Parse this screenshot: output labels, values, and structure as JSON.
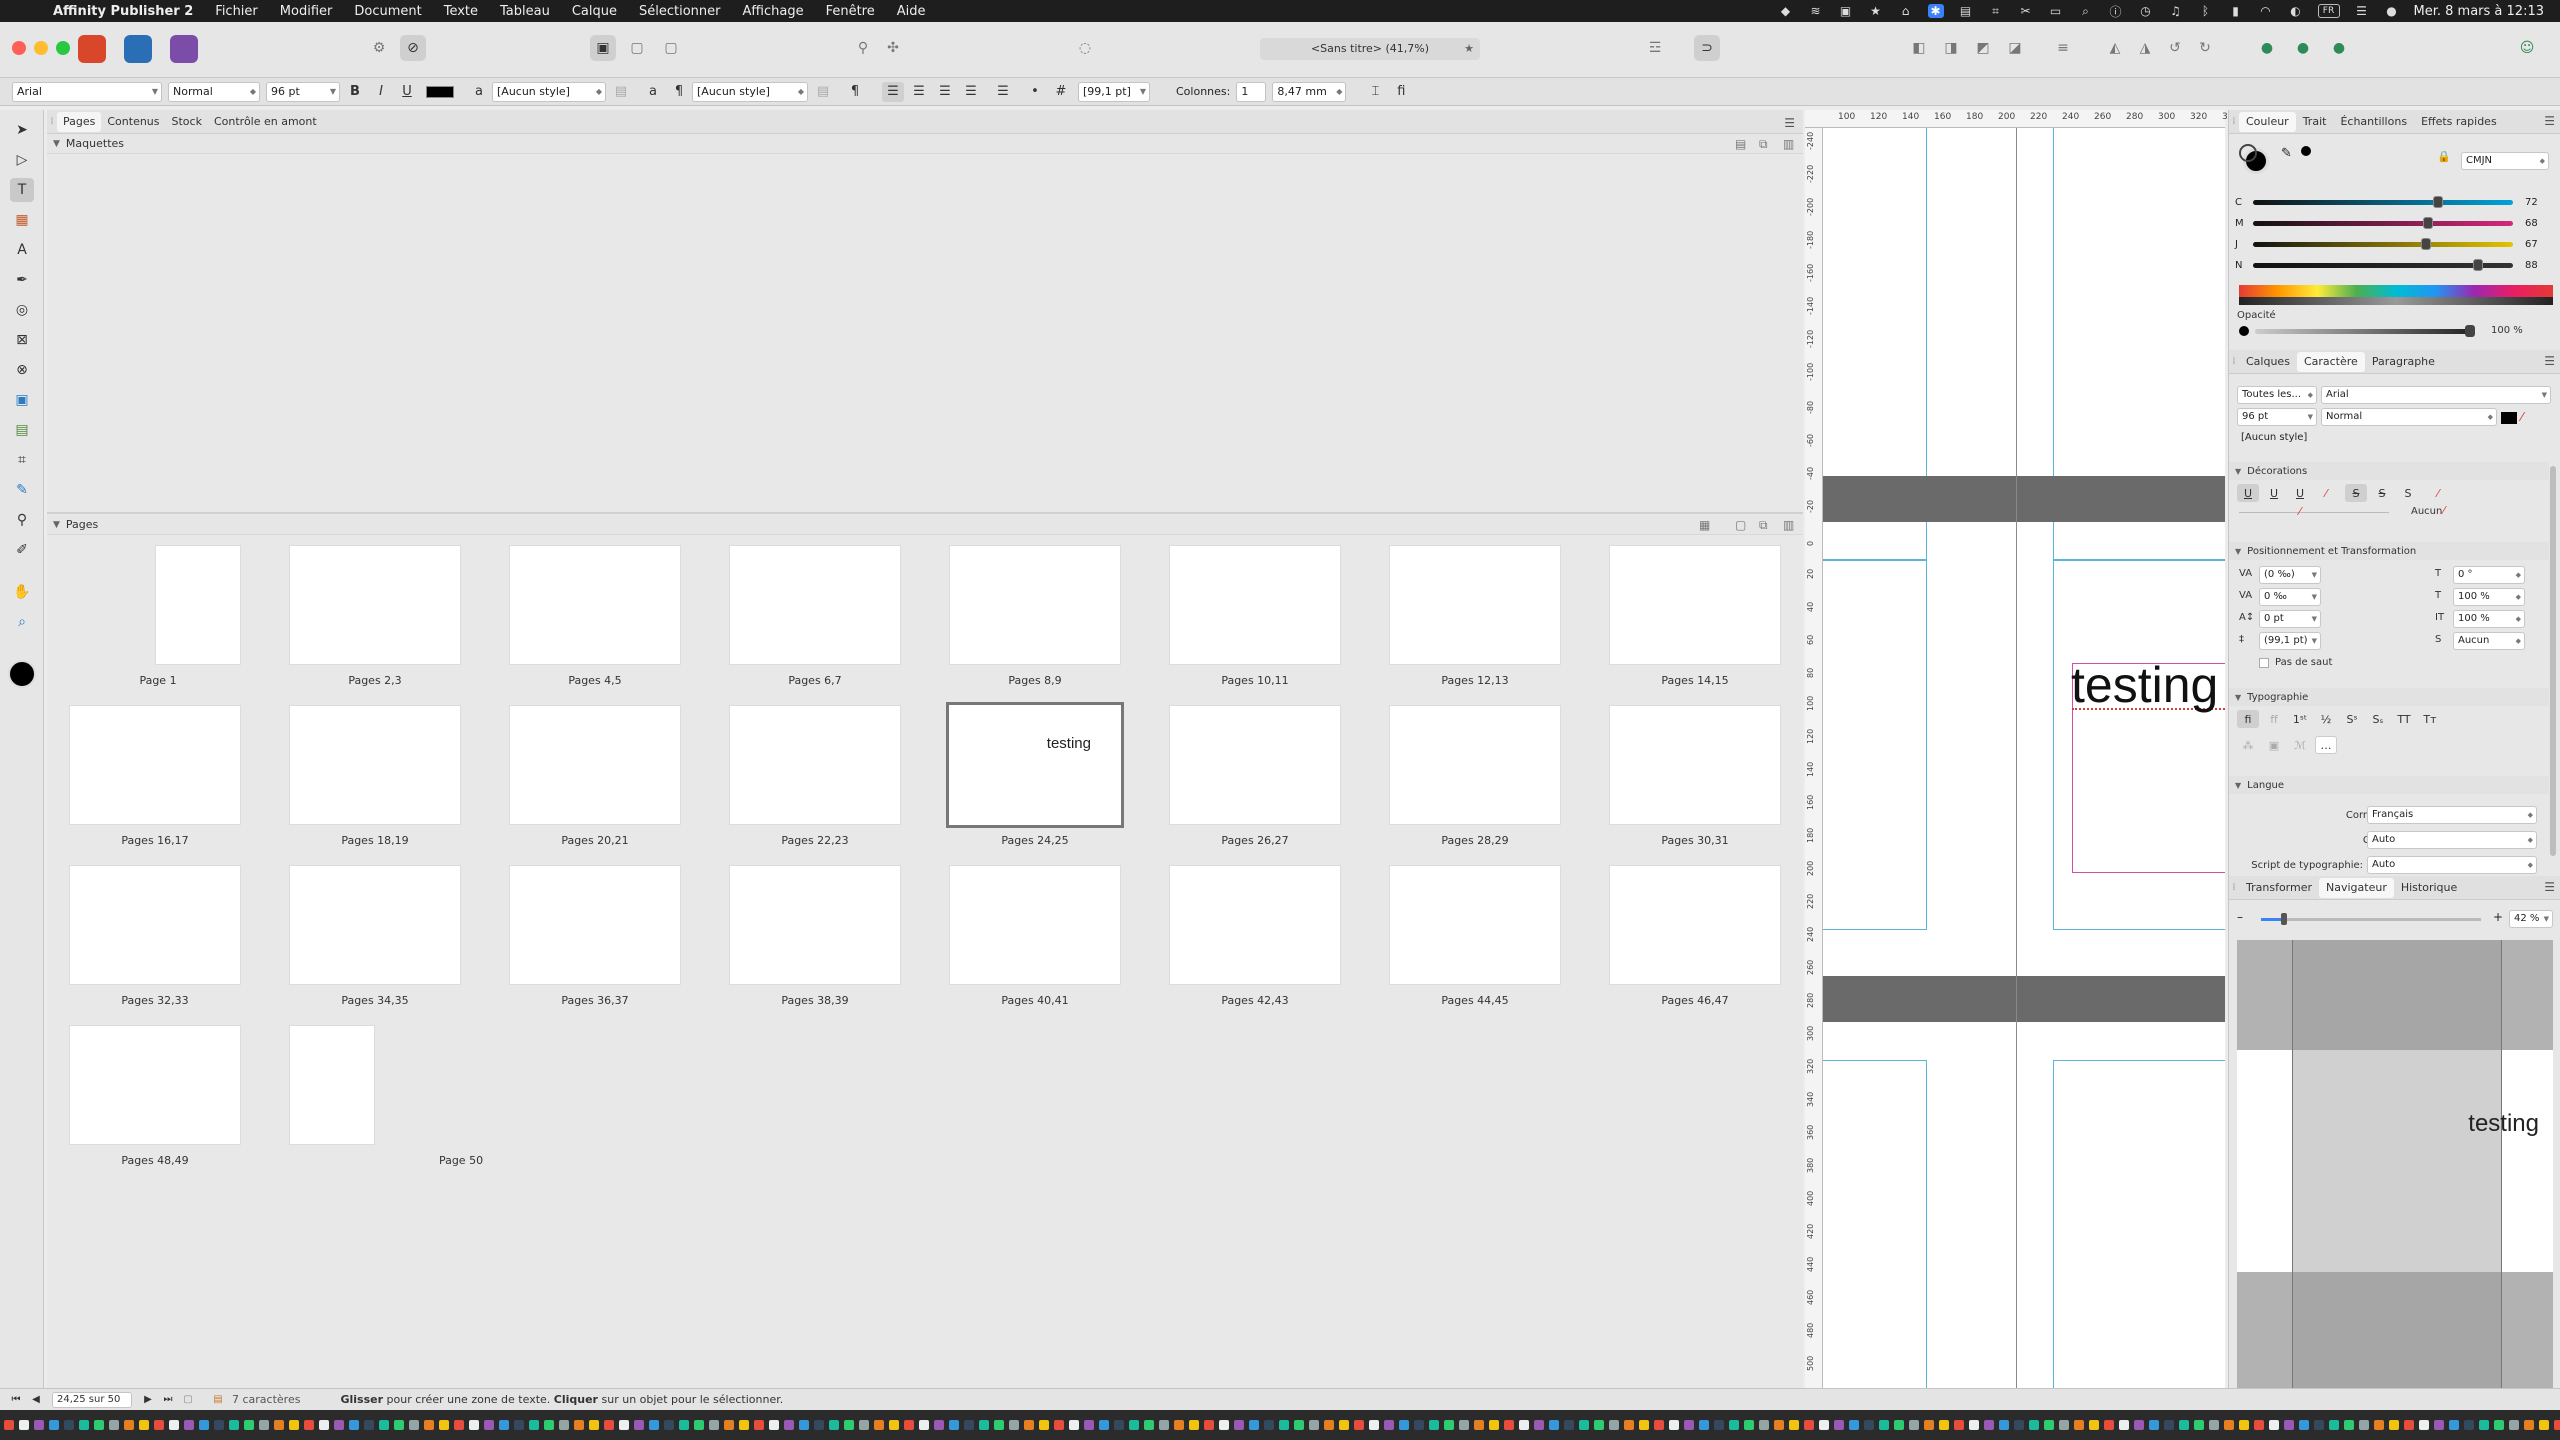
{
  "menubar": {
    "app": "Affinity Publisher 2",
    "items": [
      "Fichier",
      "Modifier",
      "Document",
      "Texte",
      "Tableau",
      "Calque",
      "Sélectionner",
      "Affichage",
      "Fenêtre",
      "Aide"
    ],
    "lang_badge": "FR",
    "clock": "Mer. 8 mars à 12:13"
  },
  "titlebar": {
    "doc_title": "<Sans titre> (41,7%)"
  },
  "ctxbar": {
    "font": "Arial",
    "style": "Normal",
    "size": "96 pt",
    "bold": "B",
    "italic": "I",
    "underline": "U",
    "char_style": "[Aucun style]",
    "para_style": "[Aucun style]",
    "leading": "[99,1 pt]",
    "columns_label": "Colonnes:",
    "columns_value": "1",
    "gutter": "8,47 mm"
  },
  "pages_panel": {
    "tabs": [
      "Pages",
      "Contenus",
      "Stock",
      "Contrôle en amont"
    ],
    "active_tab": "Pages",
    "maquettes_label": "Maquettes",
    "pages_label": "Pages",
    "spreads": [
      {
        "label": "Page 1",
        "single": true
      },
      {
        "label": "Pages 2,3"
      },
      {
        "label": "Pages 4,5"
      },
      {
        "label": "Pages 6,7"
      },
      {
        "label": "Pages 8,9"
      },
      {
        "label": "Pages 10,11"
      },
      {
        "label": "Pages 12,13"
      },
      {
        "label": "Pages 14,15"
      },
      {
        "label": "Pages 16,17"
      },
      {
        "label": "Pages 18,19"
      },
      {
        "label": "Pages 20,21"
      },
      {
        "label": "Pages 22,23"
      },
      {
        "label": "Pages 24,25",
        "current": true,
        "text": "testing"
      },
      {
        "label": "Pages 26,27"
      },
      {
        "label": "Pages 28,29"
      },
      {
        "label": "Pages 30,31"
      },
      {
        "label": "Pages 32,33"
      },
      {
        "label": "Pages 34,35"
      },
      {
        "label": "Pages 36,37"
      },
      {
        "label": "Pages 38,39"
      },
      {
        "label": "Pages 40,41"
      },
      {
        "label": "Pages 42,43"
      },
      {
        "label": "Pages 44,45"
      },
      {
        "label": "Pages 46,47"
      },
      {
        "label": "Pages 48,49"
      },
      {
        "label": "Page 50",
        "single": true
      }
    ]
  },
  "canvas": {
    "ruler_unit": "mm",
    "ruler_top": [
      "100",
      "120",
      "140",
      "160",
      "180",
      "200",
      "220",
      "240",
      "260",
      "280",
      "300",
      "320",
      "340"
    ],
    "ruler_left": [
      "-240",
      "-220",
      "-200",
      "-180",
      "-160",
      "-140",
      "-120",
      "-100",
      "-80",
      "-60",
      "-40",
      "-20",
      "0",
      "20",
      "40",
      "60",
      "80",
      "100",
      "120",
      "140",
      "160",
      "180",
      "200",
      "220",
      "240",
      "260",
      "280",
      "300",
      "320",
      "340",
      "360",
      "380",
      "400",
      "420",
      "440",
      "460",
      "480",
      "500",
      "520"
    ],
    "text": "testing"
  },
  "color_panel": {
    "tabs": [
      "Couleur",
      "Trait",
      "Échantillons",
      "Effets rapides"
    ],
    "active_tab": "Couleur",
    "model": "CMJN",
    "channels": [
      {
        "label": "C",
        "value": "72",
        "pct": 72,
        "color": "#00a3d9"
      },
      {
        "label": "M",
        "value": "68",
        "pct": 68,
        "color": "#d6287b"
      },
      {
        "label": "J",
        "value": "67",
        "pct": 67,
        "color": "#e2c400"
      },
      {
        "label": "N",
        "value": "88",
        "pct": 88,
        "color": "#333333"
      }
    ],
    "opacity_label": "Opacité",
    "opacity_value": "100 %"
  },
  "char_panel": {
    "tabs": [
      "Calques",
      "Caractère",
      "Paragraphe"
    ],
    "active_tab": "Caractère",
    "scope": "Toutes les...",
    "font": "Arial",
    "size": "96 pt",
    "style": "Normal",
    "char_style": "[Aucun style]",
    "decorations_label": "Décorations",
    "deco_none": "Aucun",
    "positioning_label": "Positionnement et Transformation",
    "tracking": "(0 ‰)",
    "kerning": "0 ‰",
    "baseline": "0 pt",
    "leading": "(99,1 pt)",
    "skew": "0 °",
    "vscale": "100 %",
    "hscale": "100 %",
    "shear": "Aucun",
    "no_break": "Pas de saut",
    "typography_label": "Typographie",
    "language_label": "Langue",
    "correction_label": "Correction:",
    "correction_value": "Français",
    "hyphen_label": "Césure:",
    "hyphen_value": "Auto",
    "script_label": "Script de typographie:",
    "script_value": "Auto"
  },
  "nav_panel": {
    "tabs": [
      "Transformer",
      "Navigateur",
      "Historique"
    ],
    "active_tab": "Navigateur",
    "zoom": "42 %",
    "zoom_pct": 42,
    "preview_text": "testing"
  },
  "status": {
    "page": "24,25 sur 50",
    "chars": "7 caractères",
    "hint_bold1": "Glisser",
    "hint_mid": " pour créer une zone de texte. ",
    "hint_bold2": "Cliquer",
    "hint_end": " sur un objet pour le sélectionner."
  }
}
